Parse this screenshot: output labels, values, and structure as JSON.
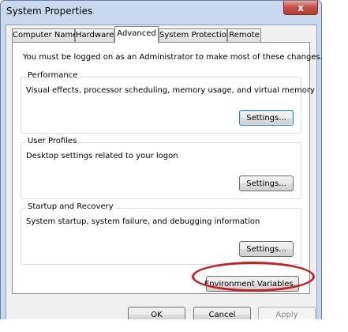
{
  "window": {
    "title": "System Properties",
    "close_label": "x"
  },
  "tabs": [
    {
      "label": "Computer Name",
      "active": false
    },
    {
      "label": "Hardware",
      "active": false
    },
    {
      "label": "Advanced",
      "active": true
    },
    {
      "label": "System Protection",
      "active": false
    },
    {
      "label": "Remote",
      "active": false
    }
  ],
  "advanced": {
    "admin_message": "You must be logged on as an Administrator to make most of these changes.",
    "performance": {
      "title": "Performance",
      "description": "Visual effects, processor scheduling, memory usage, and virtual memory",
      "settings_label": "Settings..."
    },
    "user_profiles": {
      "title": "User Profiles",
      "description": "Desktop settings related to your logon",
      "settings_label": "Settings..."
    },
    "startup_recovery": {
      "title": "Startup and Recovery",
      "description": "System startup, system failure, and debugging information",
      "settings_label": "Settings..."
    },
    "env_vars_label": "Environment Variables..."
  },
  "footer": {
    "ok_label": "OK",
    "cancel_label": "Cancel",
    "apply_label": "Apply"
  },
  "colors": {
    "highlight_ellipse": "#c81e28",
    "titlebar": "#c7d9ee",
    "close_button": "#c75050"
  }
}
